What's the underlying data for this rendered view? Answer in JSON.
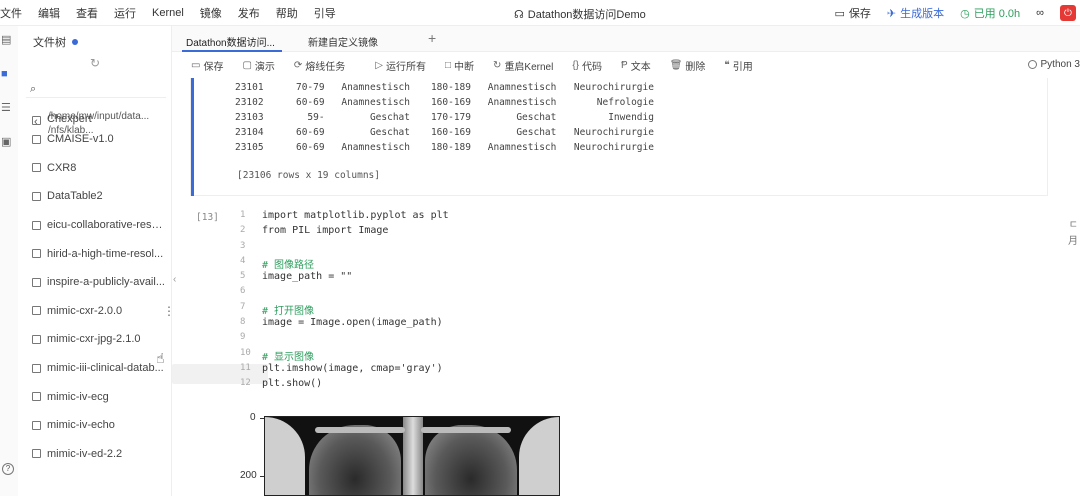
{
  "menubar": {
    "items": [
      "文件",
      "编辑",
      "查看",
      "运行",
      "Kernel",
      "镜像",
      "发布",
      "帮助",
      "引导"
    ]
  },
  "app": {
    "title": "Datathon数据访问Demo"
  },
  "top_actions": {
    "save": "保存",
    "generate_version": "生成版本",
    "runtime": "已用 0.0h"
  },
  "file_panel": {
    "title": "文件树",
    "path_line1": "/home/mw/input/data...",
    "path_line2": "/nfs/klab...",
    "items": [
      "Chexpert",
      "CMAISE-v1.0",
      "CXR8",
      "DataTable2",
      "eicu-collaborative-rese...",
      "hirid-a-high-time-resol...",
      "inspire-a-publicly-avail...",
      "mimic-cxr-2.0.0",
      "mimic-cxr-jpg-2.1.0",
      "mimic-iii-clinical-datab...",
      "mimic-iv-ecg",
      "mimic-iv-echo",
      "mimic-iv-ed-2.2"
    ]
  },
  "tabs": [
    {
      "label": "Datathon数据访问..."
    },
    {
      "label": "新建自定义镜像"
    }
  ],
  "toolbar": {
    "save": "保存",
    "demo": "演示",
    "stop_task": "熔线任务",
    "run_all": "运行所有",
    "interrupt": "中断",
    "restart_kernel": "重启Kernel",
    "code": "代码",
    "text": "文本",
    "delete": "删除",
    "cite": "引用",
    "kernel": "Python 3"
  },
  "output": {
    "rows": [
      [
        "23101",
        "70-79",
        "Anamnestisch",
        "180-189",
        "Anamnestisch",
        "Neurochirurgie"
      ],
      [
        "23102",
        "60-69",
        "Anamnestisch",
        "160-169",
        "Anamnestisch",
        "Nefrologie"
      ],
      [
        "23103",
        "59-",
        "Geschat",
        "170-179",
        "Geschat",
        "Inwendig"
      ],
      [
        "23104",
        "60-69",
        "Geschat",
        "160-169",
        "Geschat",
        "Neurochirurgie"
      ],
      [
        "23105",
        "60-69",
        "Anamnestisch",
        "180-189",
        "Anamnestisch",
        "Neurochirurgie"
      ]
    ],
    "summary": "[23106 rows x 19 columns]"
  },
  "code_cell": {
    "exec_count": "[13]",
    "lines": [
      {
        "n": "1",
        "code": "import matplotlib.pyplot as plt"
      },
      {
        "n": "2",
        "code": "from PIL import Image"
      },
      {
        "n": "3",
        "code": ""
      },
      {
        "n": "4",
        "code": "# 图像路径"
      },
      {
        "n": "5",
        "code": "image_path = \"\""
      },
      {
        "n": "6",
        "code": ""
      },
      {
        "n": "7",
        "code": "# 打开图像"
      },
      {
        "n": "8",
        "code": "image = Image.open(image_path)"
      },
      {
        "n": "9",
        "code": ""
      },
      {
        "n": "10",
        "code": "# 显示图像"
      },
      {
        "n": "11",
        "code": "plt.imshow(image, cmap='gray')"
      },
      {
        "n": "12",
        "code": "plt.show()"
      }
    ]
  },
  "image_output": {
    "tick_0": "0",
    "tick_200": "200"
  },
  "right_edge": {
    "line1": "ㄷ",
    "line2": "月"
  }
}
